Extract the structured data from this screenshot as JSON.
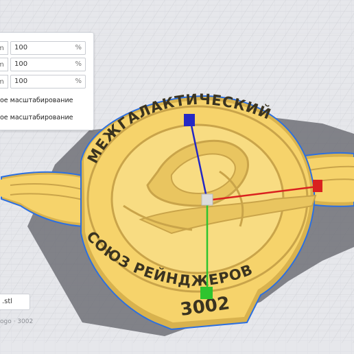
{
  "viewport": {
    "model": {
      "top_arc_text": "МЕЖГАЛАКТИЧЕСКИЙ",
      "bottom_arc_text": "СОЮЗ РЕЙНДЖЕРОВ",
      "year_text": "3002"
    },
    "colors": {
      "grid_bg": "#e6e7eb",
      "grid_line": "#c9ccd2",
      "model_fill": "#f6d36b",
      "model_shade": "#d8b24e",
      "model_outline": "#2c6fe0",
      "shadow": "#6e7077",
      "axis_x": "#d9211f",
      "axis_y": "#2ec42e",
      "axis_z": "#2428c4"
    }
  },
  "scale_tool": {
    "rows": [
      {
        "unit_cut": "m",
        "value": "100",
        "unit": "%"
      },
      {
        "unit_cut": "m",
        "value": "100",
        "unit": "%"
      },
      {
        "unit_cut": "m",
        "value": "100",
        "unit": "%"
      }
    ],
    "checkbox_1_label": "ое масштабирование",
    "checkbox_2_label": "ое масштабирование"
  },
  "object_list": {
    "file_chip_label": ".stl",
    "caption": "ogo · 3002"
  }
}
